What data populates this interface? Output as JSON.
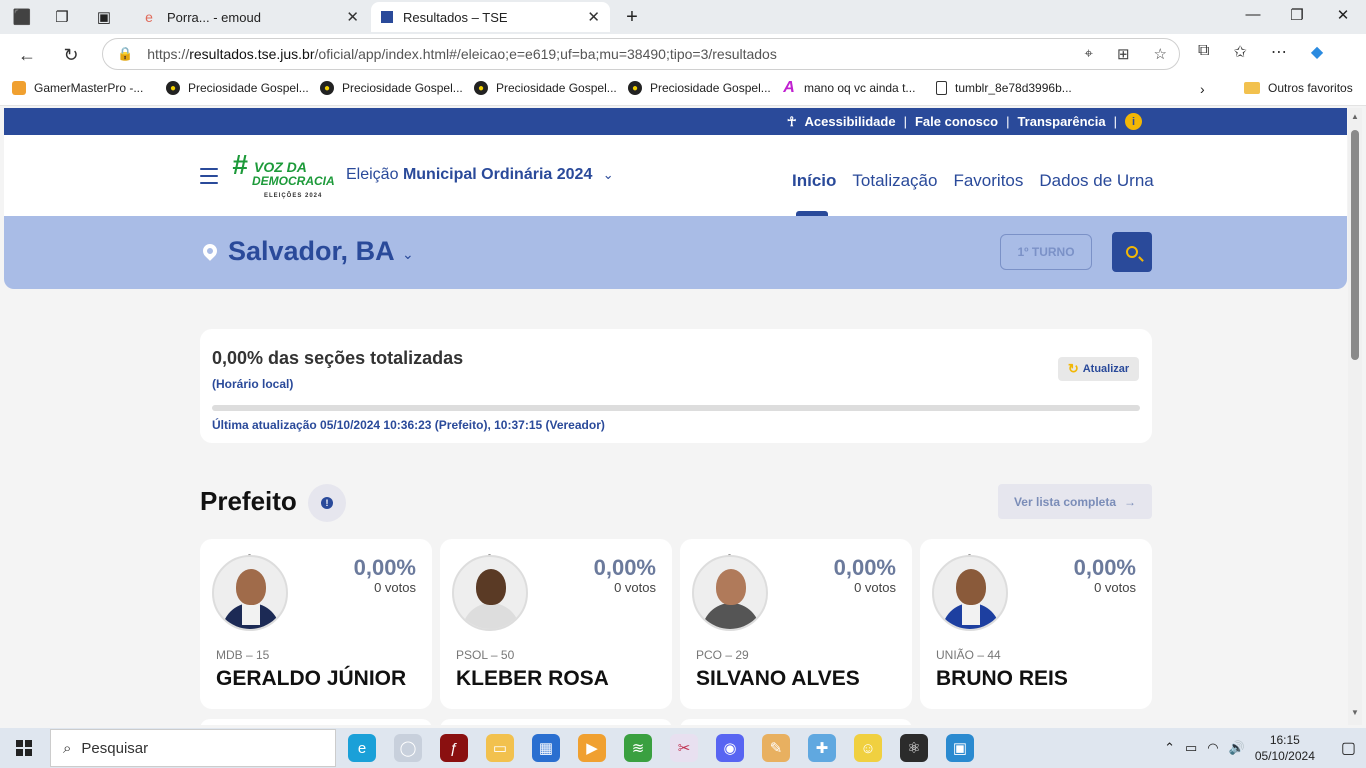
{
  "browser": {
    "tabs": [
      {
        "title": "Porra... - emoud",
        "favicon": "e",
        "active": false
      },
      {
        "title": "Resultados – TSE",
        "favicon": "tse-icon",
        "active": true
      }
    ],
    "url": {
      "prefix": "https://",
      "host": "resultados.tse.jus.br",
      "path": "/oficial/app/index.html#/eleicao;e=e619;uf=ba;mu=38490;tipo=3/resultados"
    },
    "bookmarks": [
      "GamerMasterPro -...",
      "Preciosidade Gospel...",
      "Preciosidade Gospel...",
      "Preciosidade Gospel...",
      "Preciosidade Gospel...",
      "mano oq vc ainda t...",
      "tumblr_8e78d3996b..."
    ],
    "other_favorites": "Outros favoritos"
  },
  "site": {
    "topbar": {
      "accessibility": "Acessibilidade",
      "contact": "Fale conosco",
      "transparency": "Transparência",
      "sep": "|",
      "info_glyph": "i"
    },
    "logo": {
      "hash": "#",
      "line1": "VOZ DA",
      "line2": "DEMOCRACIA",
      "line3": "ELEIÇÕES 2024"
    },
    "election": {
      "prefix": "Eleição",
      "name": "Municipal Ordinária 2024"
    },
    "nav": [
      "Início",
      "Totalização",
      "Favoritos",
      "Dados de Urna"
    ],
    "location": {
      "city": "Salvador, BA",
      "turno": "1º TURNO"
    },
    "status": {
      "percent_text": "0,00% das seções totalizadas",
      "local_time": "(Horário local)",
      "refresh": "Atualizar",
      "progress": 0,
      "last_update": "Última atualização 05/10/2024 10:36:23 (Prefeito), 10:37:15 (Vereador)"
    },
    "section": {
      "title": "Prefeito",
      "see_all": "Ver lista completa",
      "info_glyph": "!"
    },
    "candidates": [
      {
        "party": "MDB – 15",
        "name": "GERALDO JÚNIOR",
        "percent": "0,00%",
        "votes": "0 votos"
      },
      {
        "party": "PSOL – 50",
        "name": "KLEBER ROSA",
        "percent": "0,00%",
        "votes": "0 votos"
      },
      {
        "party": "PCO – 29",
        "name": "SILVANO ALVES",
        "percent": "0,00%",
        "votes": "0 votos"
      },
      {
        "party": "UNIÃO – 44",
        "name": "BRUNO REIS",
        "percent": "0,00%",
        "votes": "0 votos"
      }
    ]
  },
  "taskbar": {
    "search": "Pesquisar",
    "time": "16:15",
    "date": "05/10/2024"
  },
  "colors": {
    "primary": "#2a4a9a",
    "band": "#a9bce6",
    "accent": "#f2b705"
  }
}
